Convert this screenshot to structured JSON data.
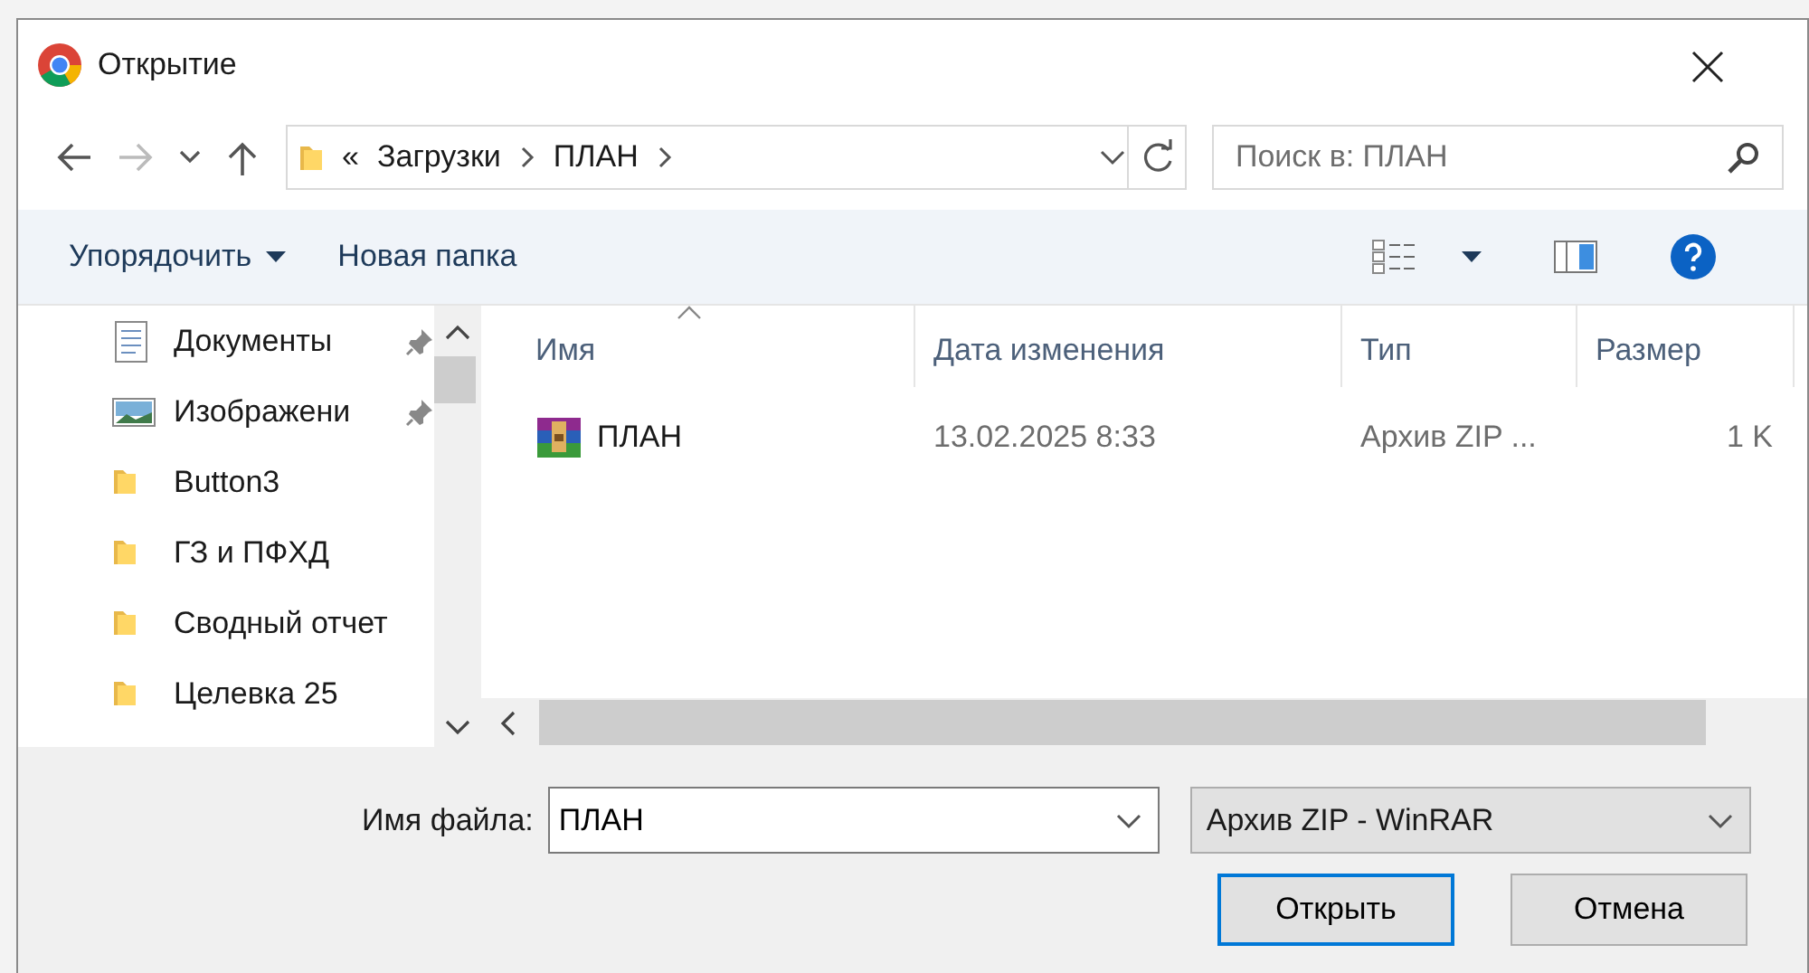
{
  "window": {
    "title": "Открытие"
  },
  "address": {
    "crumbs": [
      {
        "label": "«",
        "kind": "overflow"
      },
      {
        "label": "Загрузки",
        "kind": "folder"
      },
      {
        "label": "ПЛАН",
        "kind": "folder"
      }
    ]
  },
  "search": {
    "placeholder": "Поиск в: ПЛАН"
  },
  "toolbar": {
    "organize": "Упорядочить",
    "new_folder": "Новая папка"
  },
  "nav_pane": {
    "items": [
      {
        "label": "Документы",
        "kind": "documents",
        "pinned": true
      },
      {
        "label": "Изображени",
        "kind": "pictures",
        "pinned": true
      },
      {
        "label": "Button3",
        "kind": "folder",
        "pinned": false
      },
      {
        "label": "ГЗ и ПФХД",
        "kind": "folder",
        "pinned": false
      },
      {
        "label": "Сводный отчет",
        "kind": "folder",
        "pinned": false
      },
      {
        "label": "Целевка 25",
        "kind": "folder",
        "pinned": false
      }
    ]
  },
  "file_list": {
    "columns": [
      {
        "label": "Имя",
        "sorted": true
      },
      {
        "label": "Дата изменения",
        "sorted": false
      },
      {
        "label": "Тип",
        "sorted": false
      },
      {
        "label": "Размер",
        "sorted": false
      }
    ],
    "rows": [
      {
        "name": "ПЛАН",
        "date": "13.02.2025 8:33",
        "type": "Архив ZIP ...",
        "size": "1 K",
        "selected": false
      }
    ]
  },
  "file_name": {
    "label": "Имя файла:",
    "value": "ПЛАН"
  },
  "file_type": {
    "value": "Архив ZIP - WinRAR"
  },
  "buttons": [
    {
      "label": "Открыть",
      "default": true
    },
    {
      "label": "Отмена",
      "default": false
    }
  ]
}
